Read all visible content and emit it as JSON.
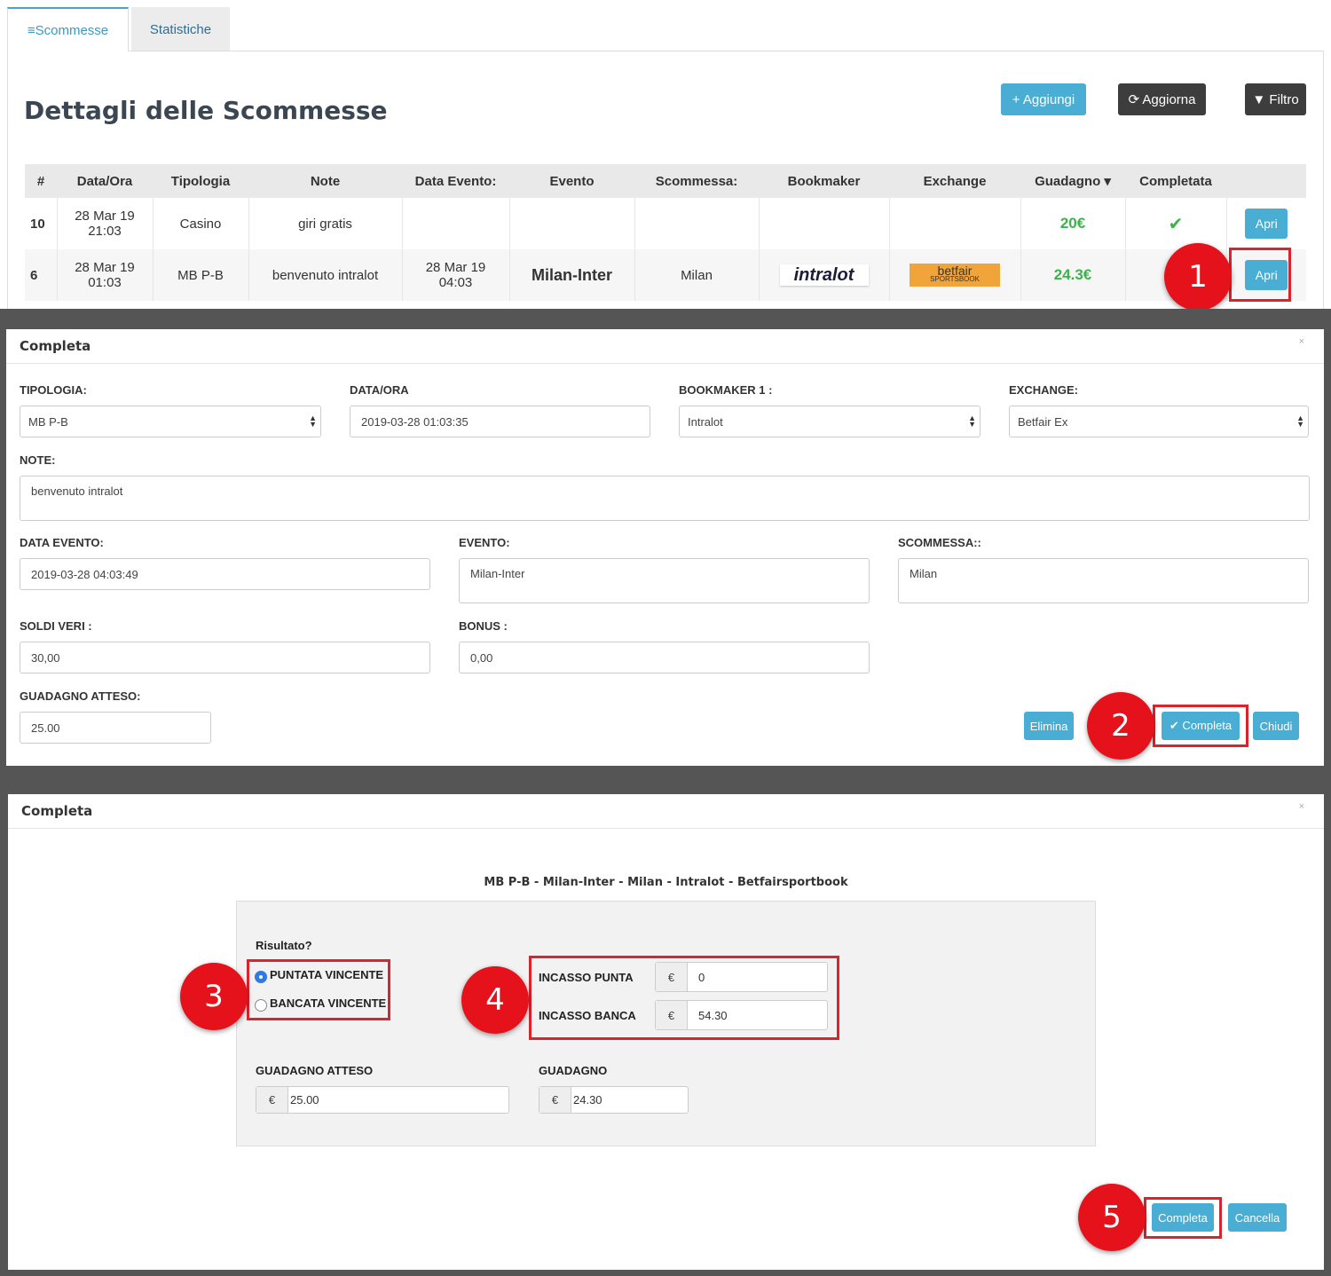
{
  "tabs": [
    {
      "label": "≡Scommesse",
      "active": true
    },
    {
      "label": "Statistiche",
      "active": false
    }
  ],
  "page_title": "Dettagli delle Scommesse",
  "toolbar": {
    "add_label": "+ Aggiungi",
    "update_label": "⟳ Aggiorna",
    "filter_label": "▼ Filtro"
  },
  "table": {
    "headers": [
      "#",
      "Data/Ora",
      "Tipologia",
      "Note",
      "Data Evento:",
      "Evento",
      "Scommessa:",
      "Bookmaker",
      "Exchange",
      "Guadagno ▾",
      "Completata",
      ""
    ],
    "rows": [
      {
        "id": "10",
        "date1": "28 Mar 19",
        "date2": "21:03",
        "tipo": "Casino",
        "note": "giri gratis",
        "ev_date1": "",
        "ev_date2": "",
        "evento": "",
        "scommessa": "",
        "bookmaker": "",
        "exchange": "",
        "guadagno": "20€",
        "completata": "✔",
        "action": "Apri"
      },
      {
        "id": "6",
        "date1": "28 Mar 19",
        "date2": "01:03",
        "tipo": "MB P-B",
        "note": "benvenuto intralot",
        "ev_date1": "28 Mar 19",
        "ev_date2": "04:03",
        "evento": "Milan-Inter",
        "scommessa": "Milan",
        "bookmaker": "intralot",
        "exchange": "betfair",
        "exchange_sub": "SPORTSBOOK",
        "guadagno": "24.3€",
        "completata": "",
        "action": "Apri"
      }
    ]
  },
  "step_numbers": [
    "1",
    "2",
    "3",
    "4",
    "5"
  ],
  "modal1": {
    "title": "Completa",
    "close": "×",
    "tipologia_label": "TIPOLOGIA:",
    "tipologia_value": "MB P-B",
    "dataora_label": "DATA/ORA",
    "dataora_value": "2019-03-28 01:03:35",
    "bookmaker_label": "BOOKMAKER 1 :",
    "bookmaker_value": "Intralot",
    "exchange_label": "EXCHANGE:",
    "exchange_value": "Betfair Ex",
    "note_label": "NOTE:",
    "note_value": "benvenuto intralot",
    "data_evento_label": "DATA EVENTO:",
    "data_evento_value": "2019-03-28 04:03:49",
    "evento_label": "EVENTO:",
    "evento_value": "Milan-Inter",
    "scommessa_label": "SCOMMESSA::",
    "scommessa_value": "Milan",
    "soldi_label": "SOLDI VERI :",
    "soldi_value": "30,00",
    "bonus_label": "BONUS :",
    "bonus_value": "0,00",
    "guadagno_label": "GUADAGNO ATTESO:",
    "guadagno_value": "25.00",
    "elimina": "Elimina",
    "completa": "✔ Completa",
    "chiudi": "Chiudi"
  },
  "modal2": {
    "title": "Completa",
    "close": "×",
    "subtitle": "MB P-B - Milan-Inter - Milan - Intralot - Betfairsportbook",
    "risultato_label": "Risultato?",
    "radio1": "PUNTATA VINCENTE",
    "radio2": "BANCATA VINCENTE",
    "radio_selected": "PUNTATA VINCENTE",
    "incasso_punta_label": "INCASSO PUNTA",
    "incasso_punta_value": "0",
    "incasso_banca_label": "INCASSO BANCA",
    "incasso_banca_value": "54.30",
    "currency": "€",
    "guadagno_atteso_label": "GUADAGNO ATTESO",
    "guadagno_atteso_value": "25.00",
    "guadagno_label": "GUADAGNO",
    "guadagno_value": "24.30",
    "completa": "Completa",
    "cancella": "Cancella"
  },
  "colors": {
    "accent": "#4aaed4",
    "dark_button": "#3d3d3d",
    "annotation_red": "#d9232d",
    "gain_green": "#3bb34a"
  }
}
